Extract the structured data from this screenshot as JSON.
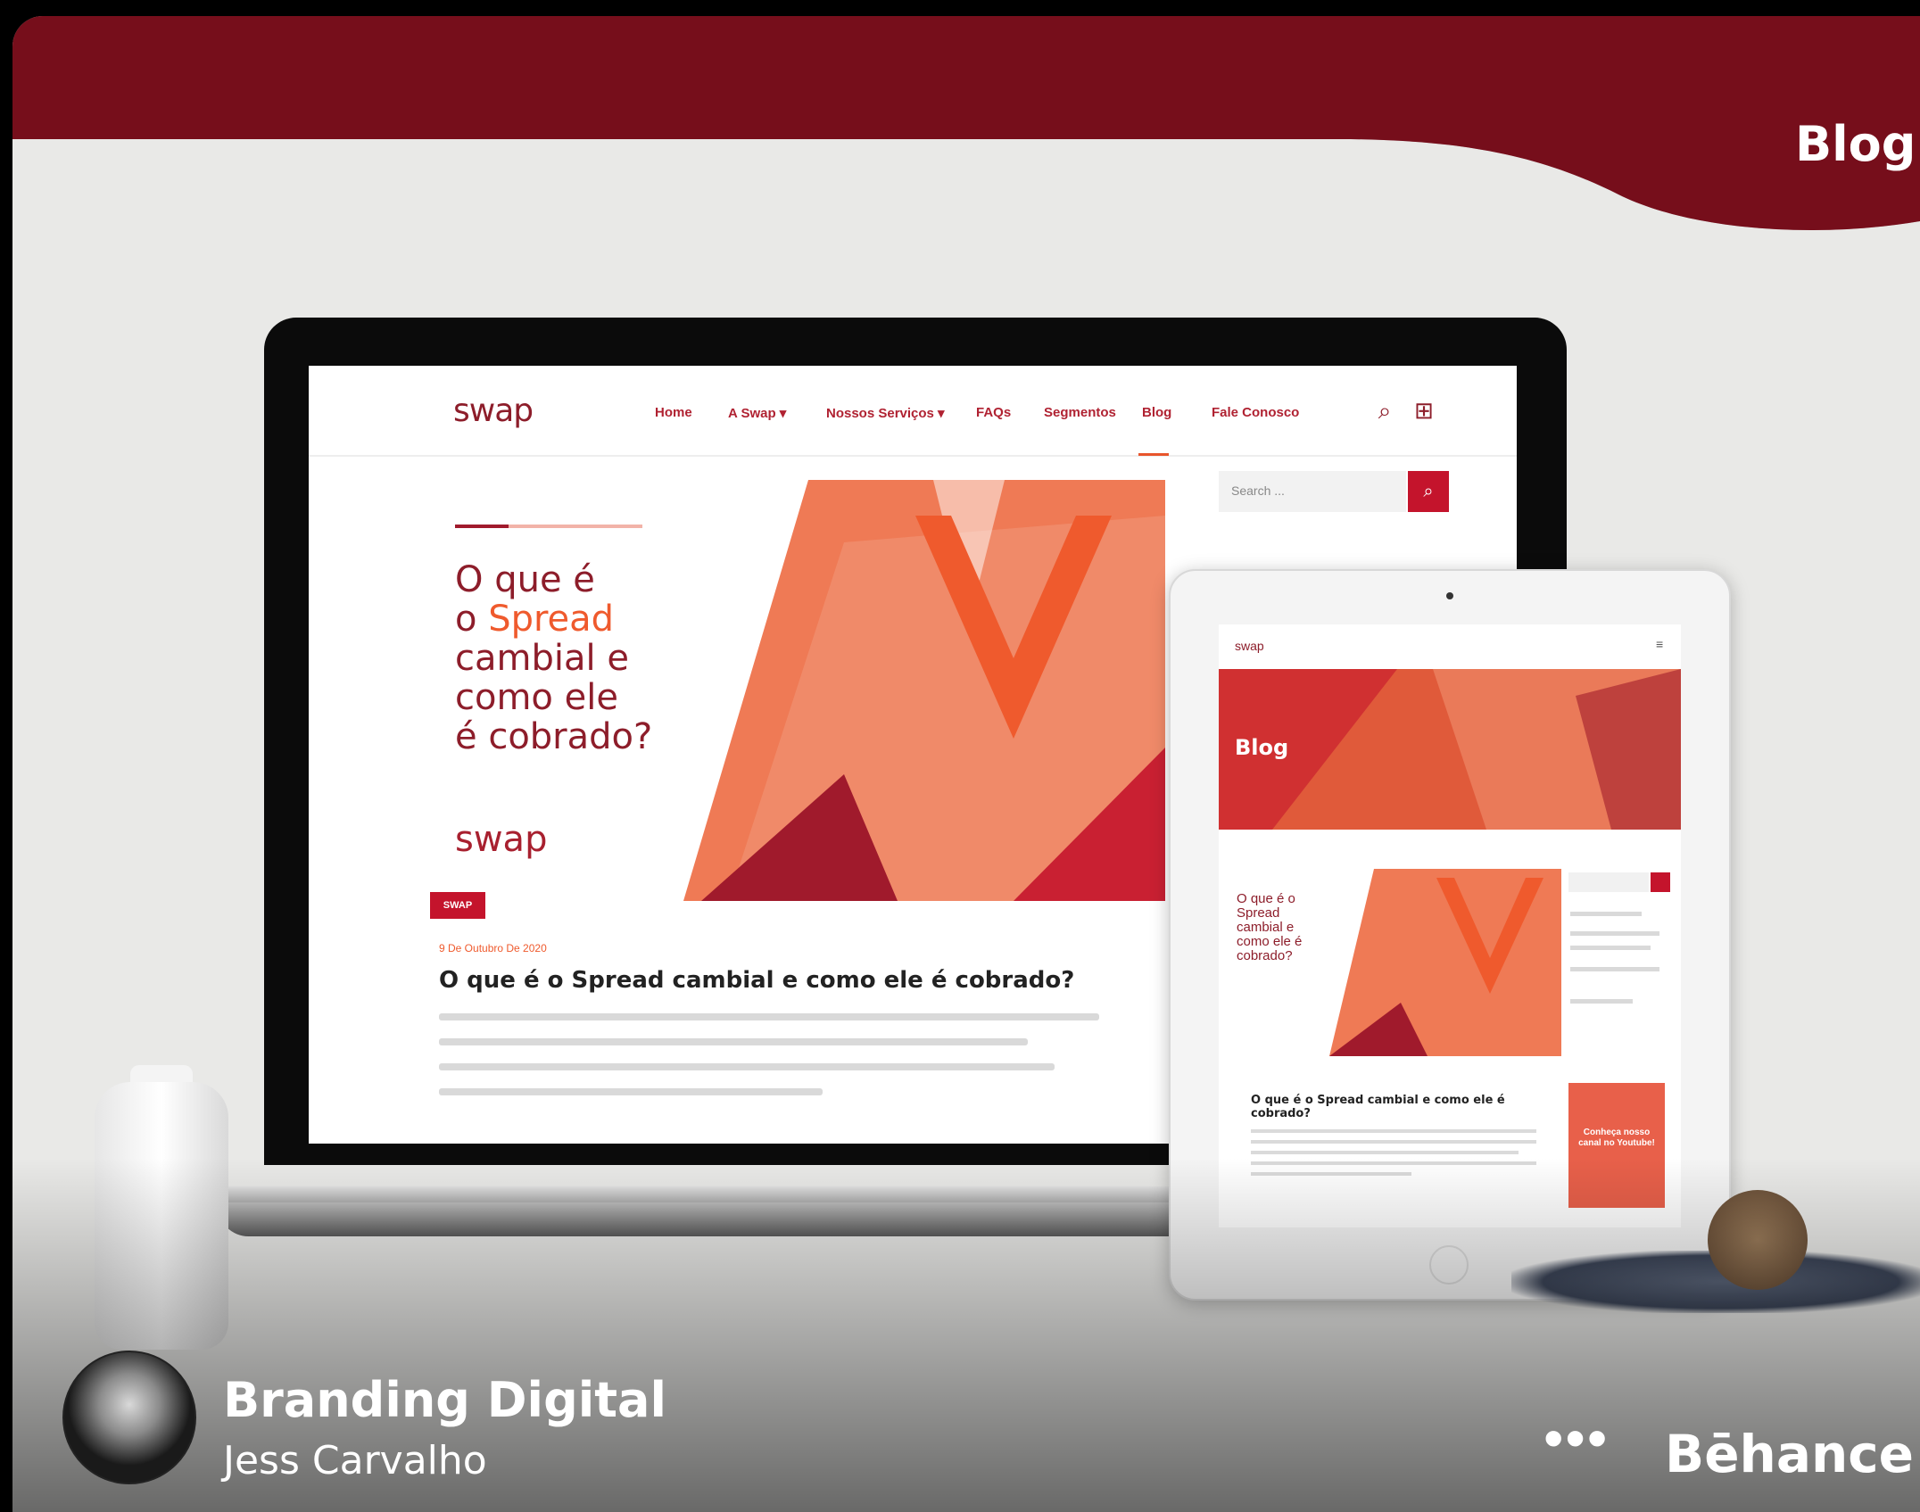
{
  "header": {
    "title": "Blog"
  },
  "laptop": {
    "logo": "swap",
    "nav": [
      "Home",
      "A Swap ▾",
      "Nossos Serviços ▾",
      "FAQs",
      "Segmentos",
      "Blog",
      "Fale Conosco"
    ],
    "search_placeholder": "Search ...",
    "hero_line1": "O que é",
    "hero_line2a": "o ",
    "hero_line2b": "Spread",
    "hero_line3": "cambial e",
    "hero_line4": "como ele",
    "hero_line5": "é cobrado?",
    "hero_logo": "swap",
    "badge": "SWAP",
    "date": "9 De Outubro De 2020",
    "post_title": "O que é o Spread cambial e como ele é cobrado?"
  },
  "tablet": {
    "logo": "swap",
    "banner_title": "Blog",
    "hero_text": "O que é o Spread cambial e como ele é cobrado?",
    "post_title": "O que é o Spread cambial e como ele é cobrado?",
    "youtube_text": "Conheça nosso canal no Youtube!"
  },
  "footer": {
    "project_title": "Branding Digital",
    "author": "Jess Carvalho",
    "more": "•••",
    "brand": "Bēhance"
  },
  "colors": {
    "brand": "#6b0c18",
    "accent": "#ef5a2d",
    "red": "#c4142c"
  }
}
